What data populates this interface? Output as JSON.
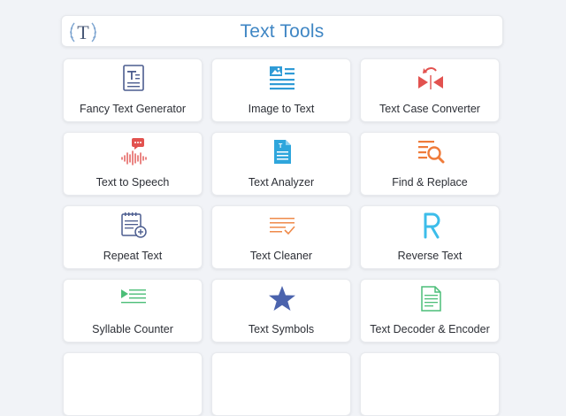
{
  "header": {
    "title": "Text Tools",
    "logo_letter": "T"
  },
  "colors": {
    "title": "#3f86c4",
    "background": "#f1f3f7",
    "card": "#ffffff"
  },
  "tools": [
    {
      "label": "Fancy Text Generator",
      "icon": "text-document-icon"
    },
    {
      "label": "Image to Text",
      "icon": "image-to-text-icon"
    },
    {
      "label": "Text Case Converter",
      "icon": "case-converter-icon"
    },
    {
      "label": "Text to Speech",
      "icon": "speech-wave-icon"
    },
    {
      "label": "Text Analyzer",
      "icon": "analyze-document-icon"
    },
    {
      "label": "Find & Replace",
      "icon": "find-magnifier-icon"
    },
    {
      "label": "Repeat Text",
      "icon": "notepad-add-icon"
    },
    {
      "label": "Text Cleaner",
      "icon": "clean-lines-check-icon"
    },
    {
      "label": "Reverse Text",
      "icon": "reverse-r-icon"
    },
    {
      "label": "Syllable Counter",
      "icon": "syllable-lines-icon"
    },
    {
      "label": "Text Symbols",
      "icon": "star-icon"
    },
    {
      "label": "Text Decoder & Encoder",
      "icon": "encoder-document-icon"
    }
  ]
}
